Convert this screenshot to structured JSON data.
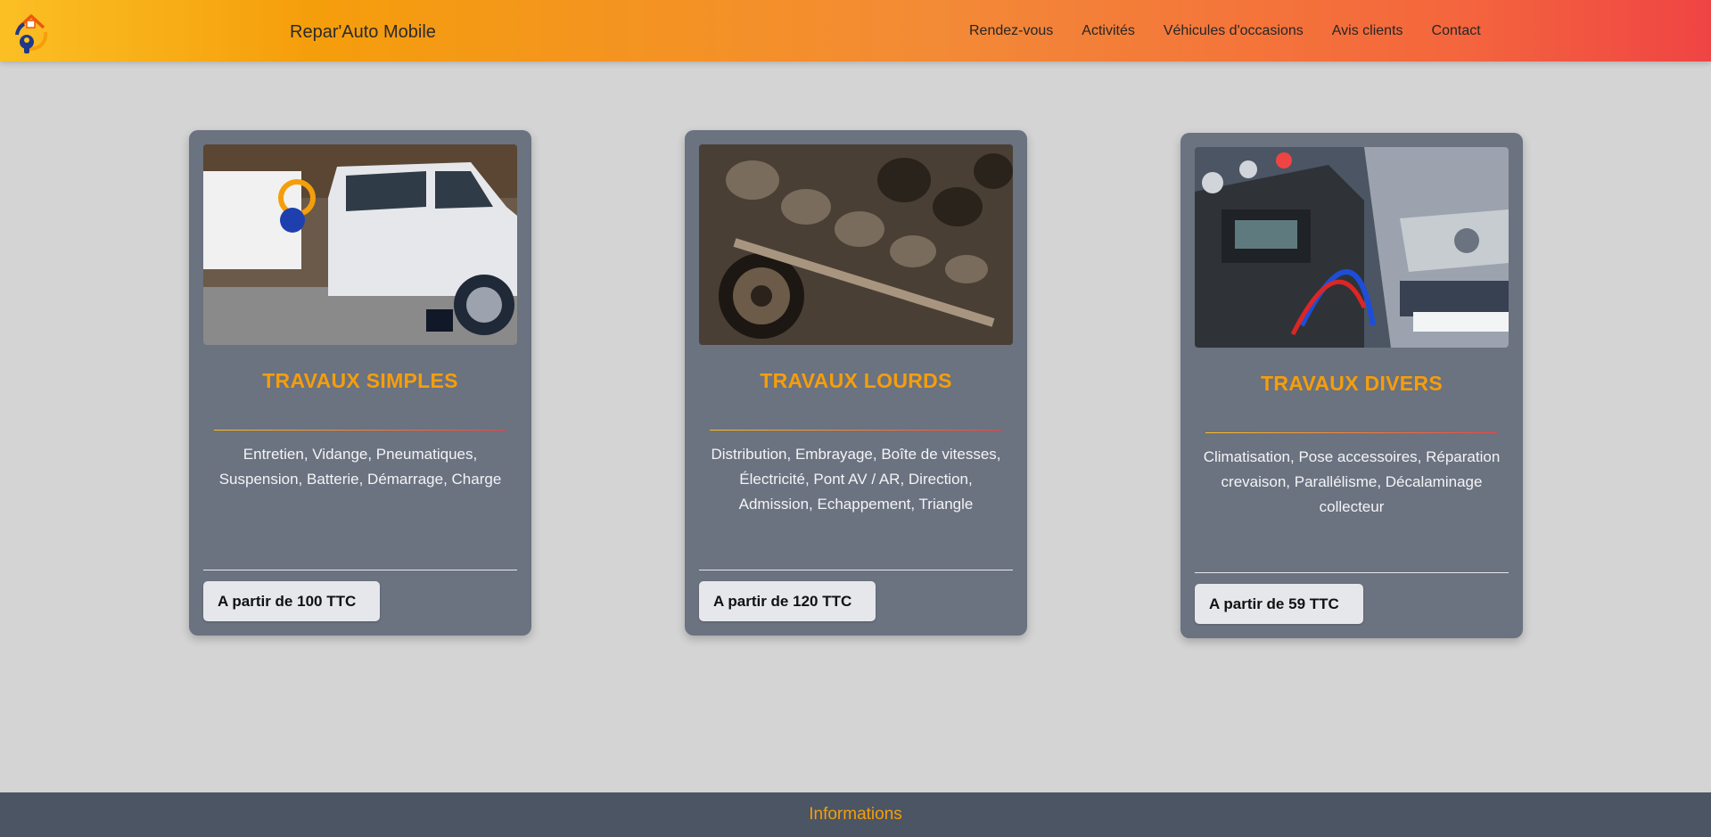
{
  "header": {
    "brand": "Repar'Auto Mobile",
    "logo_icon": "repair-home-logo-icon",
    "nav": [
      "Rendez-vous",
      "Activités",
      "Véhicules d'occasions",
      "Avis clients",
      "Contact"
    ]
  },
  "cards": [
    {
      "title": "TRAVAUX SIMPLES",
      "description": "Entretien, Vidange, Pneumatiques, Suspension, Batterie, Démarrage, Charge",
      "price": "A partir de 100 TTC",
      "image_alt": "Utility van raised on a jack in a garage"
    },
    {
      "title": "TRAVAUX LOURDS",
      "description": "Distribution, Embrayage, Boîte de vitesses, Électricité, Pont AV / AR, Direction, Admission, Echappement, Triangle",
      "price": "A partir de 120 TTC",
      "image_alt": "Close-up of an engine camshaft and valve train"
    },
    {
      "title": "TRAVAUX DIVERS",
      "description": "Climatisation, Pose accessoires, Réparation crevaison, Parallélisme, Décalaminage collecteur",
      "price": "A partir de 59 TTC",
      "image_alt": "Air conditioning recharge station connected to a car"
    }
  ],
  "footer": {
    "title": "Informations"
  },
  "colors": {
    "accent": "#f59e0b",
    "card": "#6b7280",
    "background": "#d4d4d4",
    "footer": "#4b5563"
  }
}
